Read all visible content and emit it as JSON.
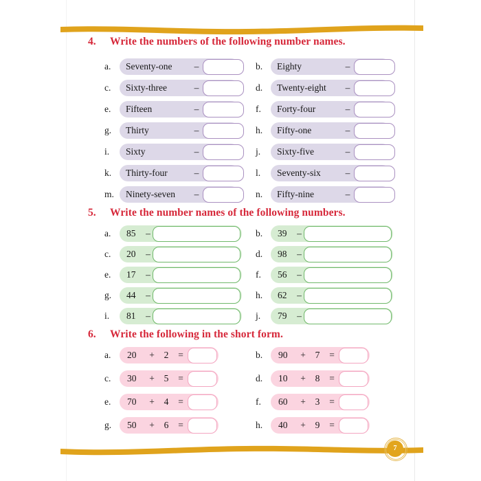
{
  "page": {
    "number": "7",
    "accent_gold": "#e0a31c",
    "heading_red": "#d6283a",
    "purple_fill": "#ddd8e8",
    "purple_border": "#a98fc0",
    "green_fill": "#d6ecd2",
    "green_border": "#6fb86a",
    "pink_fill": "#fbd4e0",
    "pink_border": "#f3a5c0"
  },
  "questions": [
    {
      "number": "4.",
      "title": "Write the numbers of the following number names.",
      "style": "purple",
      "items": [
        {
          "letter": "a.",
          "prompt": "Seventy-one",
          "dash": "–",
          "answer": ""
        },
        {
          "letter": "b.",
          "prompt": "Eighty",
          "dash": "–",
          "answer": ""
        },
        {
          "letter": "c.",
          "prompt": "Sixty-three",
          "dash": "–",
          "answer": ""
        },
        {
          "letter": "d.",
          "prompt": "Twenty-eight",
          "dash": "–",
          "answer": ""
        },
        {
          "letter": "e.",
          "prompt": "Fifteen",
          "dash": "–",
          "answer": ""
        },
        {
          "letter": "f.",
          "prompt": "Forty-four",
          "dash": "–",
          "answer": ""
        },
        {
          "letter": "g.",
          "prompt": "Thirty",
          "dash": "–",
          "answer": ""
        },
        {
          "letter": "h.",
          "prompt": "Fifty-one",
          "dash": "–",
          "answer": ""
        },
        {
          "letter": "i.",
          "prompt": "Sixty",
          "dash": "–",
          "answer": ""
        },
        {
          "letter": "j.",
          "prompt": "Sixty-five",
          "dash": "–",
          "answer": ""
        },
        {
          "letter": "k.",
          "prompt": "Thirty-four",
          "dash": "–",
          "answer": ""
        },
        {
          "letter": "l.",
          "prompt": "Seventy-six",
          "dash": "–",
          "answer": ""
        },
        {
          "letter": "m.",
          "prompt": "Ninety-seven",
          "dash": "–",
          "answer": ""
        },
        {
          "letter": "n.",
          "prompt": "Fifty-nine",
          "dash": "–",
          "answer": ""
        }
      ]
    },
    {
      "number": "5.",
      "title": "Write the number names of the following numbers.",
      "style": "green",
      "items": [
        {
          "letter": "a.",
          "prompt": "85",
          "dash": "–",
          "answer": ""
        },
        {
          "letter": "b.",
          "prompt": "39",
          "dash": "–",
          "answer": ""
        },
        {
          "letter": "c.",
          "prompt": "20",
          "dash": "–",
          "answer": ""
        },
        {
          "letter": "d.",
          "prompt": "98",
          "dash": "–",
          "answer": ""
        },
        {
          "letter": "e.",
          "prompt": "17",
          "dash": "–",
          "answer": ""
        },
        {
          "letter": "f.",
          "prompt": "56",
          "dash": "–",
          "answer": ""
        },
        {
          "letter": "g.",
          "prompt": "44",
          "dash": "–",
          "answer": ""
        },
        {
          "letter": "h.",
          "prompt": "62",
          "dash": "–",
          "answer": ""
        },
        {
          "letter": "i.",
          "prompt": "81",
          "dash": "–",
          "answer": ""
        },
        {
          "letter": "j.",
          "prompt": "79",
          "dash": "–",
          "answer": ""
        }
      ]
    },
    {
      "number": "6.",
      "title": "Write the following in the short form.",
      "style": "pink",
      "items": [
        {
          "letter": "a.",
          "num1": "20",
          "plus": "+",
          "num2": "2",
          "eq": "=",
          "answer": ""
        },
        {
          "letter": "b.",
          "num1": "90",
          "plus": "+",
          "num2": "7",
          "eq": "=",
          "answer": ""
        },
        {
          "letter": "c.",
          "num1": "30",
          "plus": "+",
          "num2": "5",
          "eq": "=",
          "answer": ""
        },
        {
          "letter": "d.",
          "num1": "10",
          "plus": "+",
          "num2": "8",
          "eq": "=",
          "answer": ""
        },
        {
          "letter": "e.",
          "num1": "70",
          "plus": "+",
          "num2": "4",
          "eq": "=",
          "answer": ""
        },
        {
          "letter": "f.",
          "num1": "60",
          "plus": "+",
          "num2": "3",
          "eq": "=",
          "answer": ""
        },
        {
          "letter": "g.",
          "num1": "50",
          "plus": "+",
          "num2": "6",
          "eq": "=",
          "answer": ""
        },
        {
          "letter": "h.",
          "num1": "40",
          "plus": "+",
          "num2": "9",
          "eq": "=",
          "answer": ""
        }
      ]
    }
  ]
}
